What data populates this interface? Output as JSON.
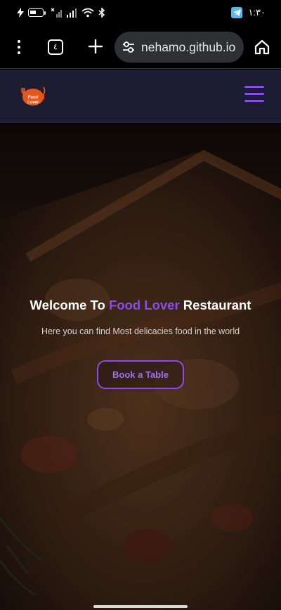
{
  "status_bar": {
    "time": "١:٣٠",
    "icons": [
      "charging-icon",
      "battery-icon",
      "no-signal-icon",
      "signal-icon",
      "wifi-icon",
      "bluetooth-icon",
      "telegram-icon"
    ]
  },
  "browser": {
    "tabs_count": "٤",
    "url": "nehamo.github.io",
    "icons": [
      "menu-dots-icon",
      "tabs-icon",
      "plus-icon",
      "tune-icon",
      "home-icon"
    ]
  },
  "site": {
    "logo_text": "Food Lover",
    "accent_color": "#8a4be8",
    "header_bg": "#1c1d33"
  },
  "hero": {
    "title_prefix": "Welcome To ",
    "title_accent": "Food Lover",
    "title_suffix": " Restaurant",
    "subtitle": "Here you can find Most delicacies food in the world",
    "cta_label": "Book a Table"
  }
}
